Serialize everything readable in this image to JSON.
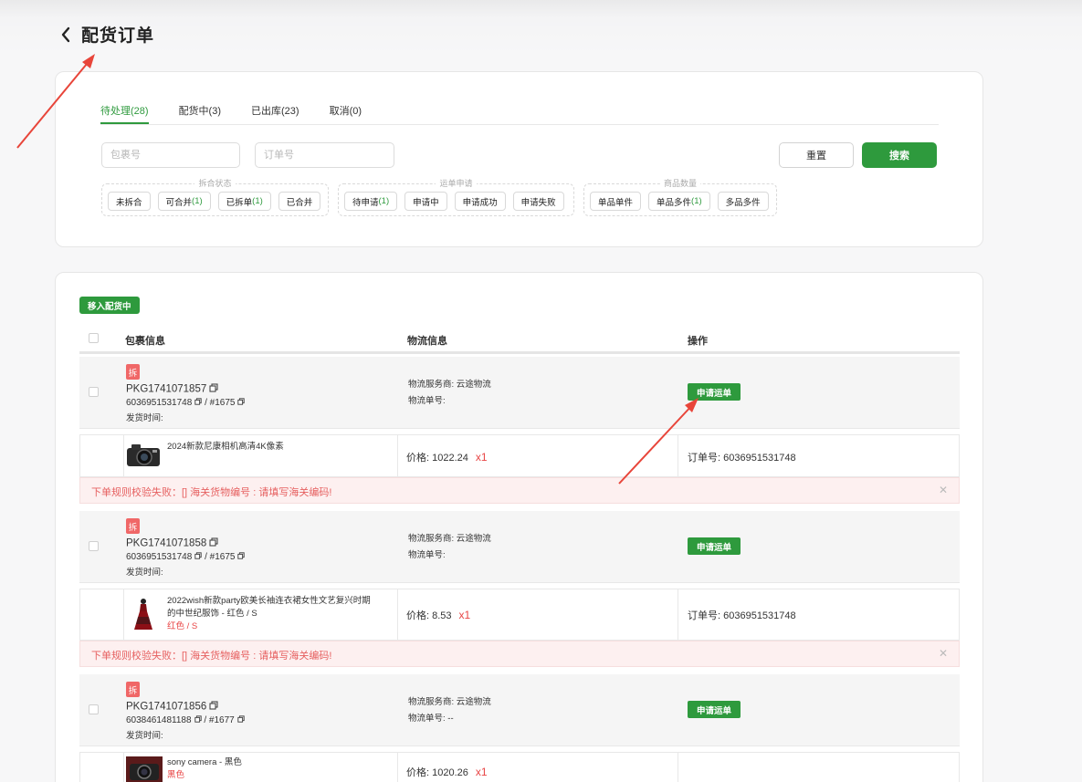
{
  "header": {
    "title": "配货订单"
  },
  "tabs": [
    {
      "label": "待处理(28)",
      "active": true
    },
    {
      "label": "配货中(3)",
      "active": false
    },
    {
      "label": "已出库(23)",
      "active": false
    },
    {
      "label": "取消(0)",
      "active": false
    }
  ],
  "search": {
    "package_placeholder": "包裹号",
    "order_placeholder": "订单号",
    "reset_label": "重置",
    "search_label": "搜索"
  },
  "filter_groups": {
    "split": {
      "title": "拆合状态",
      "options": [
        {
          "label": "未拆合",
          "count": ""
        },
        {
          "label": "可合并",
          "count": "(1)"
        },
        {
          "label": "已拆单",
          "count": "(1)"
        },
        {
          "label": "已合并",
          "count": ""
        }
      ]
    },
    "waybill": {
      "title": "运单申请",
      "options": [
        {
          "label": "待申请",
          "count": "(1)"
        },
        {
          "label": "申请中",
          "count": ""
        },
        {
          "label": "申请成功",
          "count": ""
        },
        {
          "label": "申请失败",
          "count": ""
        }
      ]
    },
    "quantity": {
      "title": "商品数量",
      "options": [
        {
          "label": "单品单件",
          "count": ""
        },
        {
          "label": "单品多件",
          "count": "(1)"
        },
        {
          "label": "多品多件",
          "count": ""
        }
      ]
    }
  },
  "list": {
    "move_label": "移入配货中",
    "columns": {
      "package": "包裹信息",
      "logistics": "物流信息",
      "action": "操作"
    }
  },
  "packages": [
    {
      "badge": "拆",
      "id": "PKG1741071857",
      "order_ref": "6036951531748",
      "order_num": "#1675",
      "ship_time_label": "发货时间:",
      "carrier": "物流服务商: 云途物流",
      "tracking": "物流单号:",
      "apply_label": "申请运单",
      "item": {
        "title": "2024新款尼康相机高清4K像素",
        "variant": "",
        "price": "价格: 1022.24",
        "qty": "x1",
        "order_no": "订单号: 6036951531748"
      },
      "error": "下单规则校验失败：[] 海关货物编号 : 请填写海关编码!"
    },
    {
      "badge": "拆",
      "id": "PKG1741071858",
      "order_ref": "6036951531748",
      "order_num": "#1675",
      "ship_time_label": "发货时间:",
      "carrier": "物流服务商: 云途物流",
      "tracking": "物流单号:",
      "apply_label": "申请运单",
      "item": {
        "title_line1": "2022wish新款party欧美长袖连衣裙女性文艺复兴时期",
        "title_line2": "的中世纪服饰 - 红色 / S",
        "variant": "红色 / S",
        "price": "价格: 8.53",
        "qty": "x1",
        "order_no": "订单号: 6036951531748"
      },
      "error": "下单规则校验失败：[] 海关货物编号 : 请填写海关编码!"
    },
    {
      "badge": "拆",
      "id": "PKG1741071856",
      "order_ref": "6038461481188",
      "order_num": "#1677",
      "ship_time_label": "发货时间:",
      "carrier": "物流服务商: 云途物流",
      "tracking": "物流单号: --",
      "apply_label": "申请运单",
      "item": {
        "title": "sony camera - 黑色",
        "variant": "黑色",
        "price": "价格: 1020.26",
        "qty": "x1",
        "order_no": ""
      }
    }
  ],
  "colors": {
    "primary": "#2e9a3d",
    "error": "#e66060",
    "badge": "#f06767"
  }
}
